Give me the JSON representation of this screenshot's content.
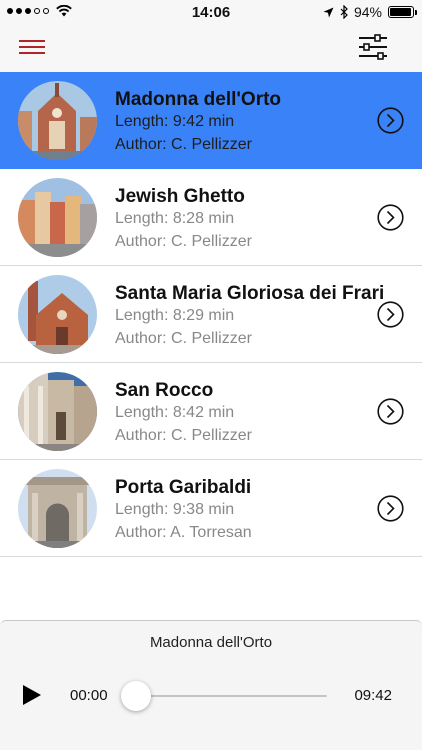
{
  "status_bar": {
    "signal_dots_filled": 3,
    "signal_dots_total": 5,
    "time": "14:06",
    "battery_text": "94%",
    "battery_level": 0.94,
    "icons": [
      "wifi-icon",
      "location-arrow-icon",
      "bluetooth-icon",
      "battery-icon"
    ]
  },
  "nav_bar": {
    "left_icon": "hamburger-menu-icon",
    "right_icon": "filter-sliders-icon",
    "accent": "#b0252a"
  },
  "tours": [
    {
      "title": "Madonna dell'Orto",
      "length": "Length: 9:42 min",
      "author": "Author: C. Pellizzer",
      "selected": true,
      "thumb": "church-brick-facade"
    },
    {
      "title": "Jewish Ghetto",
      "length": "Length: 8:28 min",
      "author": "Author: C. Pellizzer",
      "selected": false,
      "thumb": "colorful-buildings-square"
    },
    {
      "title": "Santa Maria Gloriosa dei Frari",
      "length": "Length: 8:29 min",
      "author": "Author: C. Pellizzer",
      "selected": false,
      "thumb": "brick-basilica"
    },
    {
      "title": "San Rocco",
      "length": "Length: 8:42 min",
      "author": "Author: C. Pellizzer",
      "selected": false,
      "thumb": "marble-facade"
    },
    {
      "title": "Porta Garibaldi",
      "length": "Length: 9:38 min",
      "author": "Author: A. Torresan",
      "selected": false,
      "thumb": "triumphal-arch"
    }
  ],
  "player": {
    "now_playing": "Madonna dell'Orto",
    "current_time": "00:00",
    "total_time": "09:42",
    "progress": 0,
    "play_icon": "play-icon"
  },
  "colors": {
    "selected_row": "#3a82f7",
    "secondary_text": "#888888",
    "menu_icon": "#b0252a"
  }
}
